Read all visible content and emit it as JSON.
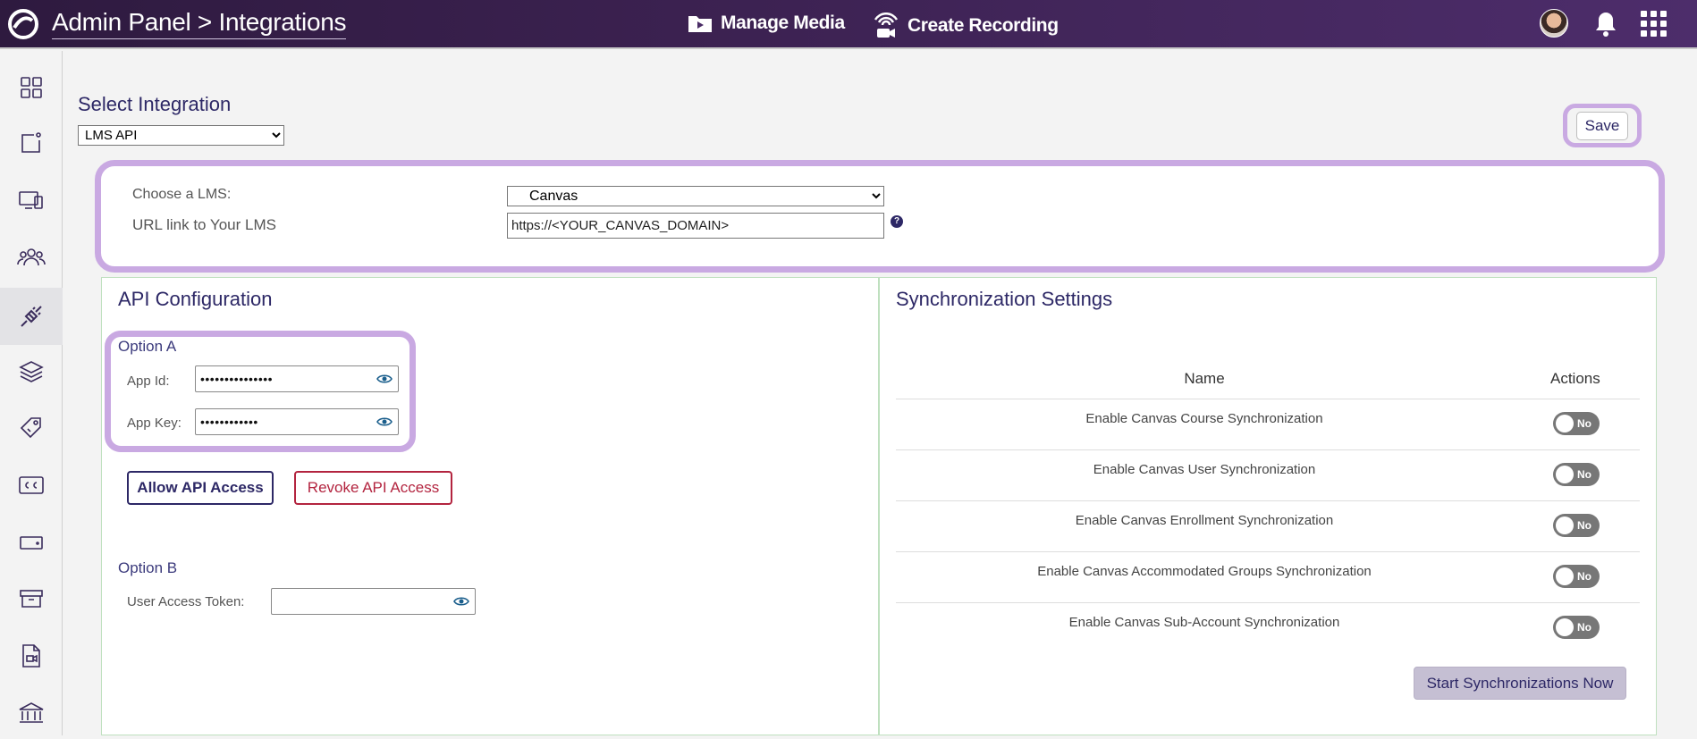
{
  "header": {
    "breadcrumb": "Admin Panel > Integrations",
    "manage_media": "Manage Media",
    "create_recording": "Create Recording"
  },
  "sidebar": {
    "items": [
      "dashboard-icon",
      "media-icon",
      "devices-icon",
      "users-icon",
      "integrations-icon",
      "layers-icon",
      "tags-icon",
      "captions-icon",
      "storage-icon",
      "archive-icon",
      "video-file-icon",
      "institution-icon"
    ]
  },
  "integration": {
    "label": "Select Integration",
    "selected": "LMS API",
    "save_label": "Save"
  },
  "lms": {
    "choose_label": "Choose a LMS:",
    "choose_value": "Canvas",
    "url_label": "URL link to Your LMS",
    "url_value": "https://<YOUR_CANVAS_DOMAIN>",
    "help": "?"
  },
  "api": {
    "title": "API Configuration",
    "option_a": "Option A",
    "app_id_label": "App Id:",
    "app_id_value": "•••••••••••••••",
    "app_key_label": "App Key:",
    "app_key_value": "••••••••••••",
    "allow_label": "Allow API Access",
    "revoke_label": "Revoke API Access",
    "option_b": "Option B",
    "token_label": "User Access Token:",
    "token_value": ""
  },
  "sync": {
    "title": "Synchronization Settings",
    "col_name": "Name",
    "col_actions": "Actions",
    "rows": [
      {
        "name": "Enable Canvas Course Synchronization",
        "state": "No"
      },
      {
        "name": "Enable Canvas User Synchronization",
        "state": "No"
      },
      {
        "name": "Enable Canvas Enrollment Synchronization",
        "state": "No"
      },
      {
        "name": "Enable Canvas Accommodated Groups Synchronization",
        "state": "No"
      },
      {
        "name": "Enable Canvas Sub-Account Synchronization",
        "state": "No"
      }
    ],
    "start_label": "Start Synchronizations Now"
  },
  "colors": {
    "accent": "#c9a9e2",
    "brand": "#2d2866",
    "danger": "#b3243f"
  }
}
